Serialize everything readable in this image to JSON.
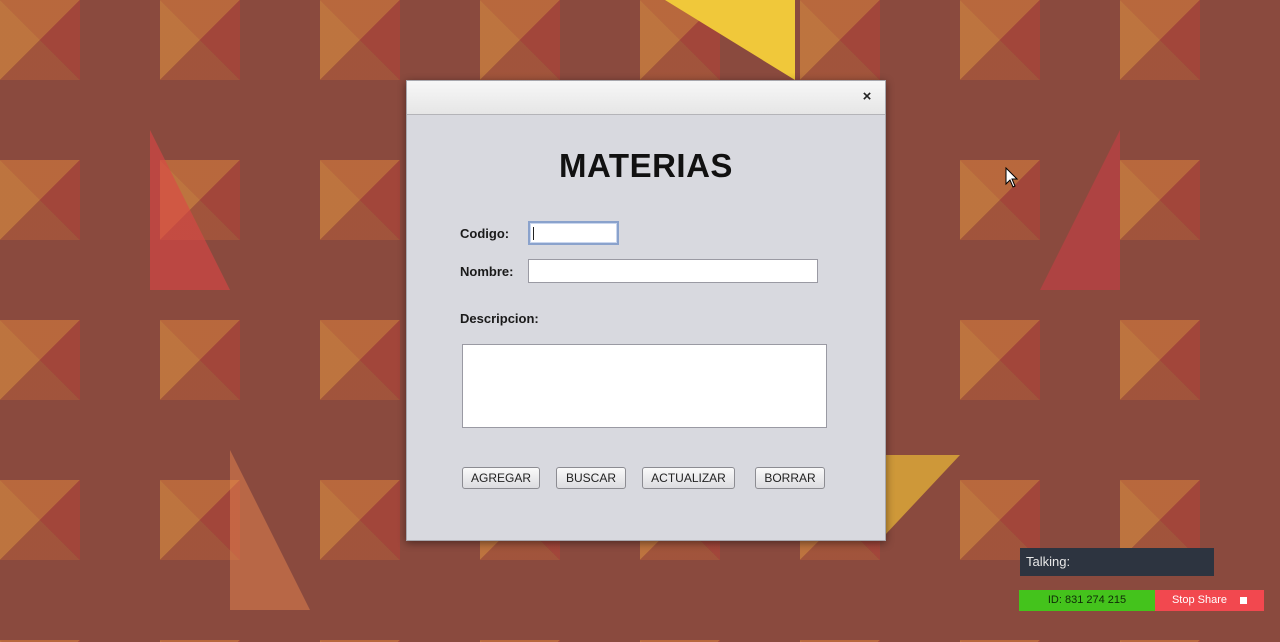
{
  "dialog": {
    "title": "MATERIAS",
    "close_glyph": "×",
    "fields": {
      "codigo_label": "Codigo:",
      "codigo_value": "",
      "nombre_label": "Nombre:",
      "nombre_value": "",
      "descripcion_label": "Descripcion:",
      "descripcion_value": ""
    },
    "buttons": {
      "agregar": "AGREGAR",
      "buscar": "BUSCAR",
      "actualizar": "ACTUALIZAR",
      "borrar": "BORRAR"
    }
  },
  "overlay": {
    "talking_label": "Talking:",
    "session_id": "ID: 831 274 215",
    "stop_share_label": "Stop Share",
    "id_color": "#44c31c",
    "stop_color": "#f2484f"
  },
  "icons": [
    "close-icon",
    "stop-icon",
    "mouse-cursor-icon"
  ]
}
